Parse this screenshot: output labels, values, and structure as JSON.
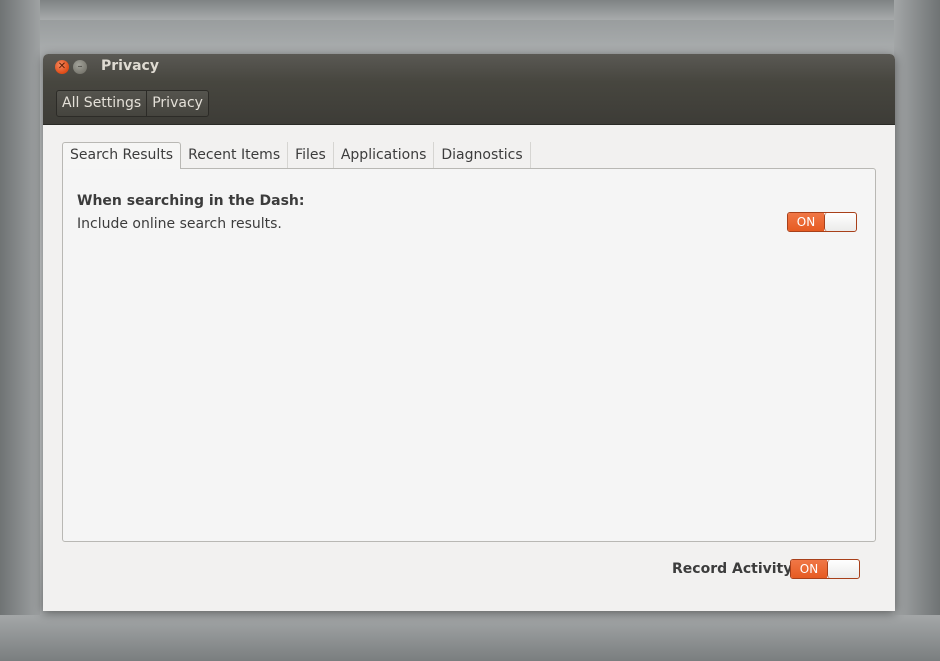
{
  "window": {
    "title": "Privacy",
    "close_glyph": "✕",
    "minimize_glyph": "–"
  },
  "breadcrumb": {
    "items": [
      {
        "label": "All Settings"
      },
      {
        "label": "Privacy"
      }
    ]
  },
  "tabs": [
    {
      "label": "Search Results",
      "active": true
    },
    {
      "label": "Recent Items",
      "active": false
    },
    {
      "label": "Files",
      "active": false
    },
    {
      "label": "Applications",
      "active": false
    },
    {
      "label": "Diagnostics",
      "active": false
    }
  ],
  "search_results": {
    "heading": "When searching in the Dash:",
    "option_label": "Include online search results.",
    "toggle_state": "ON"
  },
  "record_activity": {
    "label": "Record Activity",
    "toggle_state": "ON"
  },
  "colors": {
    "accent": "#e65b22",
    "titlebar": "#3d3c37",
    "panel_bg": "#f5f5f5"
  },
  "icons": [
    "close-icon",
    "minimize-icon"
  ]
}
